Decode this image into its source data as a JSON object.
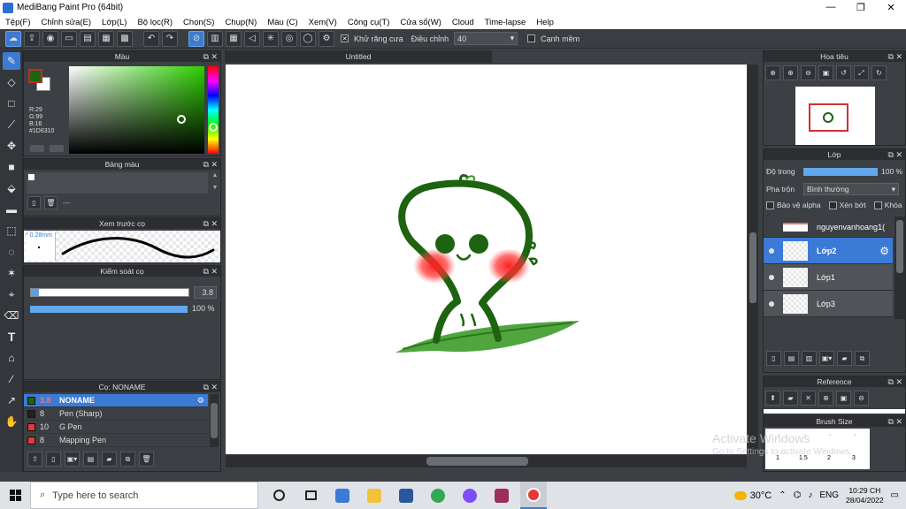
{
  "window": {
    "title": "MediBang Paint Pro (64bit)",
    "minimize": "—",
    "maximize": "❐",
    "close": "✕"
  },
  "menu": [
    "Tệp(F)",
    "Chỉnh sửa(E)",
    "Lớp(L)",
    "Bộ lọc(R)",
    "Chọn(S)",
    "Chụp(N)",
    "Màu (C)",
    "Xem(V)",
    "Công cụ(T)",
    "Cửa sổ(W)",
    "Cloud",
    "Time-lapse",
    "Help"
  ],
  "toolbar": {
    "antialias_check": "✕",
    "antialias_label": "Khử răng cưa",
    "correction_label": "Điều chỉnh",
    "correction_value": "40",
    "soft_edge_label": "Cạnh mềm"
  },
  "color_panel": {
    "title": "Màu",
    "r": "R:29",
    "g": "G:99",
    "b": "B:16",
    "hex": "#1D6310",
    "fg_color": "#1D6310"
  },
  "palette_panel": {
    "title": "Bảng màu",
    "dashes": "---"
  },
  "preview_panel": {
    "title": "Xem trước cọ",
    "size": "* 0.28mm"
  },
  "brush_control": {
    "title": "Kiểm soát cọ",
    "size_value": "3.8",
    "opacity_value": "100 %",
    "opacity": 1.0,
    "size_fraction": 0.05
  },
  "brush_panel": {
    "title": "Cọ: NONAME",
    "items": [
      {
        "size": "3.8",
        "name": "NONAME",
        "color": "#1D6310",
        "selected": true
      },
      {
        "size": "8",
        "name": "Pen (Sharp)",
        "color": "#222222",
        "selected": false
      },
      {
        "size": "10",
        "name": "G Pen",
        "color": "#e53935",
        "selected": false
      },
      {
        "size": "8",
        "name": "Mapping Pen",
        "color": "#e53935",
        "selected": false
      }
    ]
  },
  "document": {
    "tab": "Untitled"
  },
  "navigator": {
    "title": "Hoa tiêu"
  },
  "layer_panel": {
    "title": "Lớp",
    "opacity_label": "Độ trong",
    "opacity_value": "100 %",
    "opacity": 1.0,
    "blend_label": "Pha trộn",
    "blend_value": "Bình thường",
    "protect_alpha": "Bảo vệ alpha",
    "clipping": "Xén bớt",
    "lock": "Khóa",
    "layers": [
      {
        "name": "nguyenvanhoang1(",
        "selected": false,
        "top": true
      },
      {
        "name": "Lớp2",
        "selected": true,
        "top": false
      },
      {
        "name": "Lớp1",
        "selected": false,
        "top": false
      },
      {
        "name": "Lớp3",
        "selected": false,
        "top": false
      }
    ]
  },
  "reference_panel": {
    "title": "Reference"
  },
  "brush_size_panel": {
    "title": "Brush Size",
    "sizes": [
      "1",
      "1.5",
      "2",
      "3"
    ]
  },
  "watermark": {
    "line1": "Activate Windows",
    "line2": "Go to Settings to activate Windows."
  },
  "taskbar": {
    "search_placeholder": "Type here to search",
    "temperature": "30°C",
    "language": "ENG",
    "time": "10:29 CH",
    "date": "28/04/2022"
  }
}
